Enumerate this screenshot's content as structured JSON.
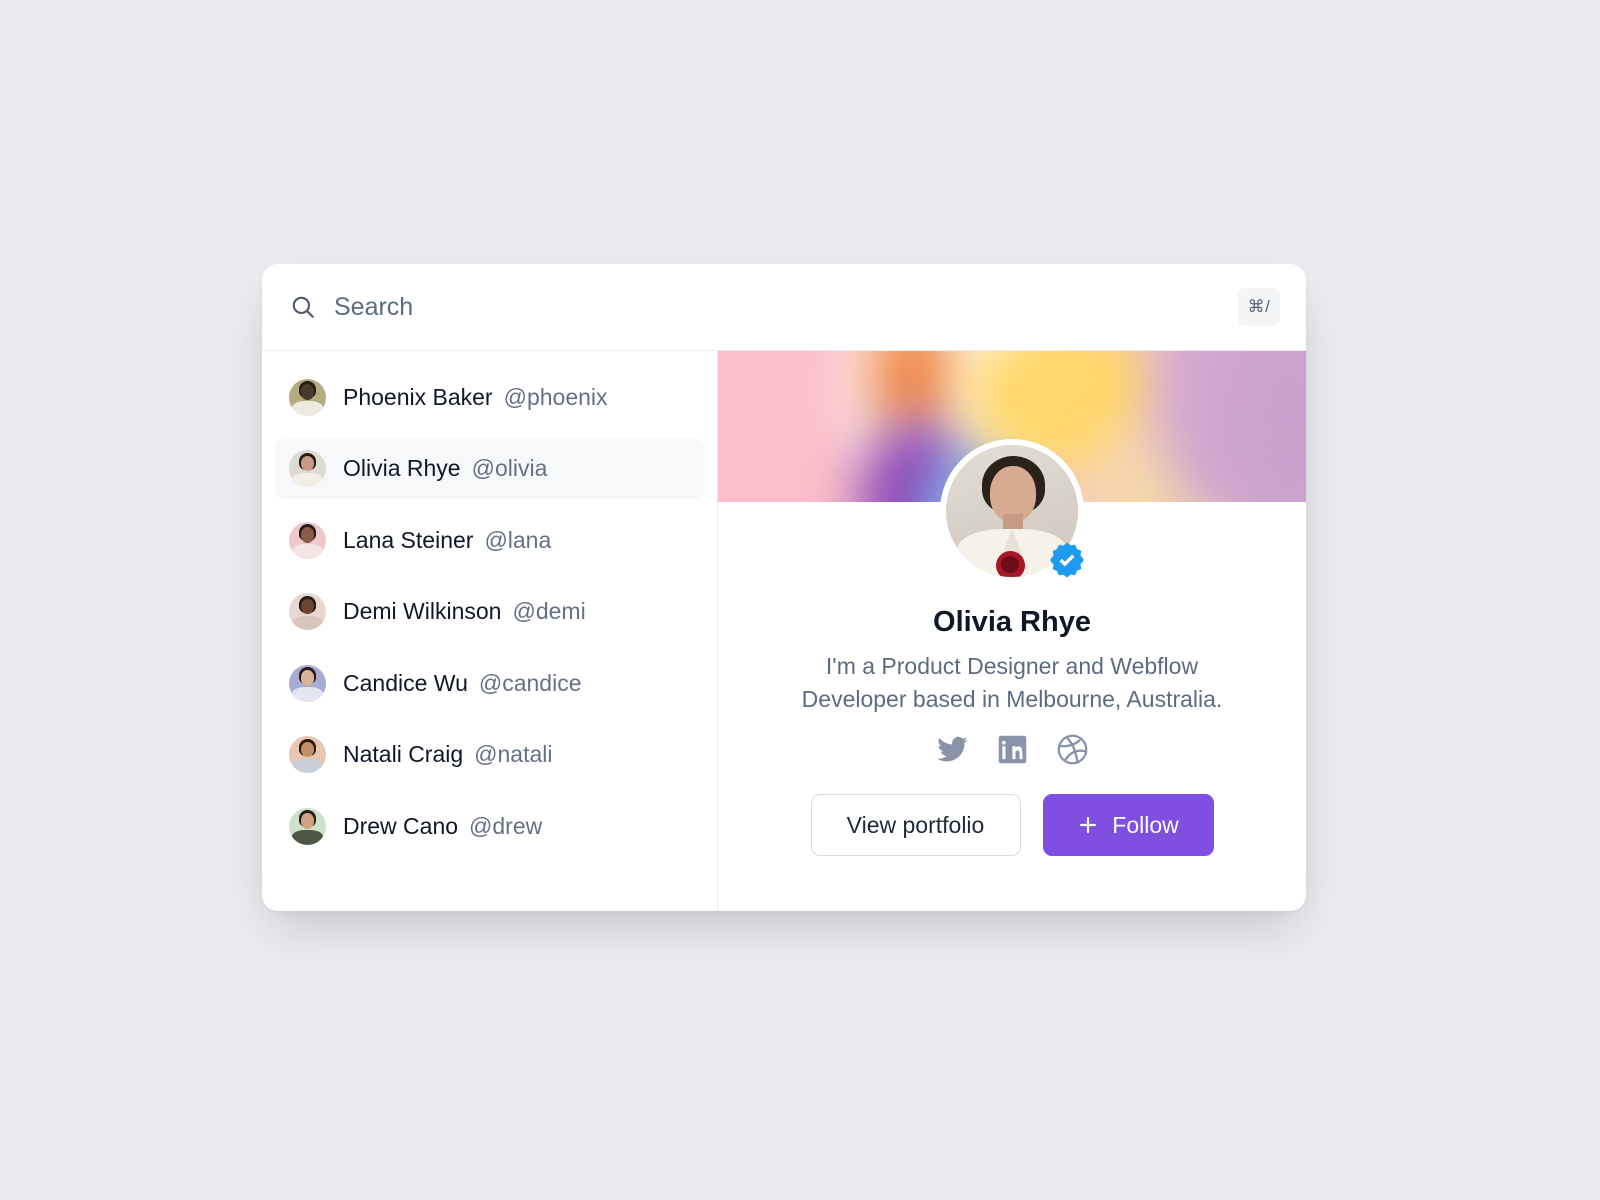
{
  "page": {
    "background_color": "#eaebef",
    "card_background": "#ffffff"
  },
  "search": {
    "icon": "search-icon",
    "value": "",
    "placeholder": "Search",
    "shortcut_badge": "⌘/"
  },
  "user_list": {
    "items": [
      {
        "name": "Phoenix Baker",
        "handle": "@phoenix",
        "selected": false,
        "avatar_icon": "avatar-phoenix",
        "avatar_bg": "#b4ab7e",
        "avatar_skin": "#4a3a2a",
        "avatar_top": "#efeade"
      },
      {
        "name": "Olivia Rhye",
        "handle": "@olivia",
        "selected": true,
        "avatar_icon": "avatar-olivia",
        "avatar_bg": "#dedbd4",
        "avatar_skin": "#c89c84",
        "avatar_top": "#f3efe8"
      },
      {
        "name": "Lana Steiner",
        "handle": "@lana",
        "selected": false,
        "avatar_icon": "avatar-lana",
        "avatar_bg": "#eec9cb",
        "avatar_skin": "#8a5b45",
        "avatar_top": "#f2e5e4"
      },
      {
        "name": "Demi Wilkinson",
        "handle": "@demi",
        "selected": false,
        "avatar_icon": "avatar-demi",
        "avatar_bg": "#e8d6cf",
        "avatar_skin": "#6d4332",
        "avatar_top": "#d8c6bd"
      },
      {
        "name": "Candice Wu",
        "handle": "@candice",
        "selected": false,
        "avatar_icon": "avatar-candice",
        "avatar_bg": "#a9aad6",
        "avatar_skin": "#d8b49a",
        "avatar_top": "#e3e5f0"
      },
      {
        "name": "Natali Craig",
        "handle": "@natali",
        "selected": false,
        "avatar_icon": "avatar-natali",
        "avatar_bg": "#e8c7b0",
        "avatar_skin": "#c58f66",
        "avatar_top": "#c9cfd8"
      },
      {
        "name": "Drew Cano",
        "handle": "@drew",
        "selected": false,
        "avatar_icon": "avatar-drew",
        "avatar_bg": "#cde3c9",
        "avatar_skin": "#d0a183",
        "avatar_top": "#4d5545"
      }
    ]
  },
  "profile": {
    "cover_icon": "cover-gradient",
    "avatar_icon": "avatar-olivia-large",
    "verified": true,
    "verified_badge_color": "#1d9bf0",
    "name": "Olivia Rhye",
    "bio": "I'm a Product Designer and Webflow Developer based in Melbourne, Australia.",
    "socials": [
      {
        "icon": "twitter-icon",
        "label": "Twitter"
      },
      {
        "icon": "linkedin-icon",
        "label": "LinkedIn"
      },
      {
        "icon": "dribbble-icon",
        "label": "Dribbble"
      }
    ],
    "actions": {
      "secondary_label": "View portfolio",
      "primary_label": "Follow",
      "primary_icon": "plus-icon",
      "primary_color": "#7e4fe0"
    }
  }
}
